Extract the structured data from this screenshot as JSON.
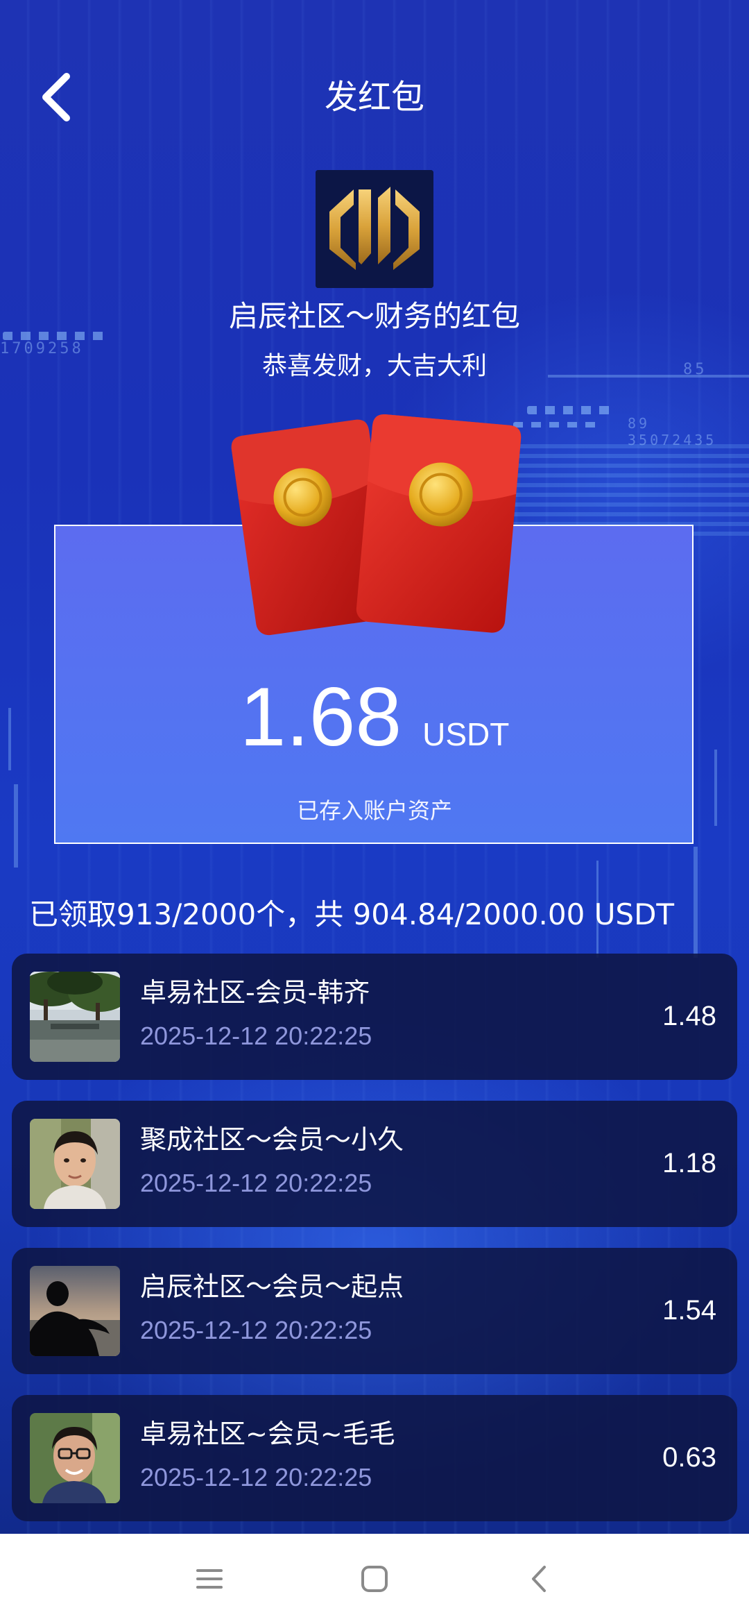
{
  "header": {
    "title": "发红包"
  },
  "sender": {
    "name": "启辰社区～财务的红包",
    "wish": "恭喜发财，大吉大利"
  },
  "packet": {
    "amount": "1.68",
    "unit": "USDT",
    "note": "已存入账户资产"
  },
  "summary": "已领取913/2000个，共 904.84/2000.00 USDT",
  "claims": [
    {
      "name": "卓易社区-会员-韩齐",
      "time": "2025-12-12 20:22:25",
      "amount": "1.48",
      "avatar": "landscape-photo"
    },
    {
      "name": "聚成社区～会员～小久",
      "time": "2025-12-12 20:22:25",
      "amount": "1.18",
      "avatar": "young-man-photo"
    },
    {
      "name": "启辰社区～会员～起点",
      "time": "2025-12-12 20:22:25",
      "amount": "1.54",
      "avatar": "silhouette-sunset-photo"
    },
    {
      "name": "卓易社区~会员~毛毛",
      "time": "2025-12-12 20:22:25",
      "amount": "0.63",
      "avatar": "man-glasses-photo"
    }
  ],
  "nav": {
    "icons": [
      "menu-icon",
      "home-square-icon",
      "back-chevron-icon"
    ]
  },
  "colors": {
    "background": "#1a32b8",
    "card": "#5a72f0",
    "list_item": "#0e1646",
    "time_text": "#8f97dc",
    "envelope": "#d81e1e",
    "seal": "#e8b41e"
  }
}
